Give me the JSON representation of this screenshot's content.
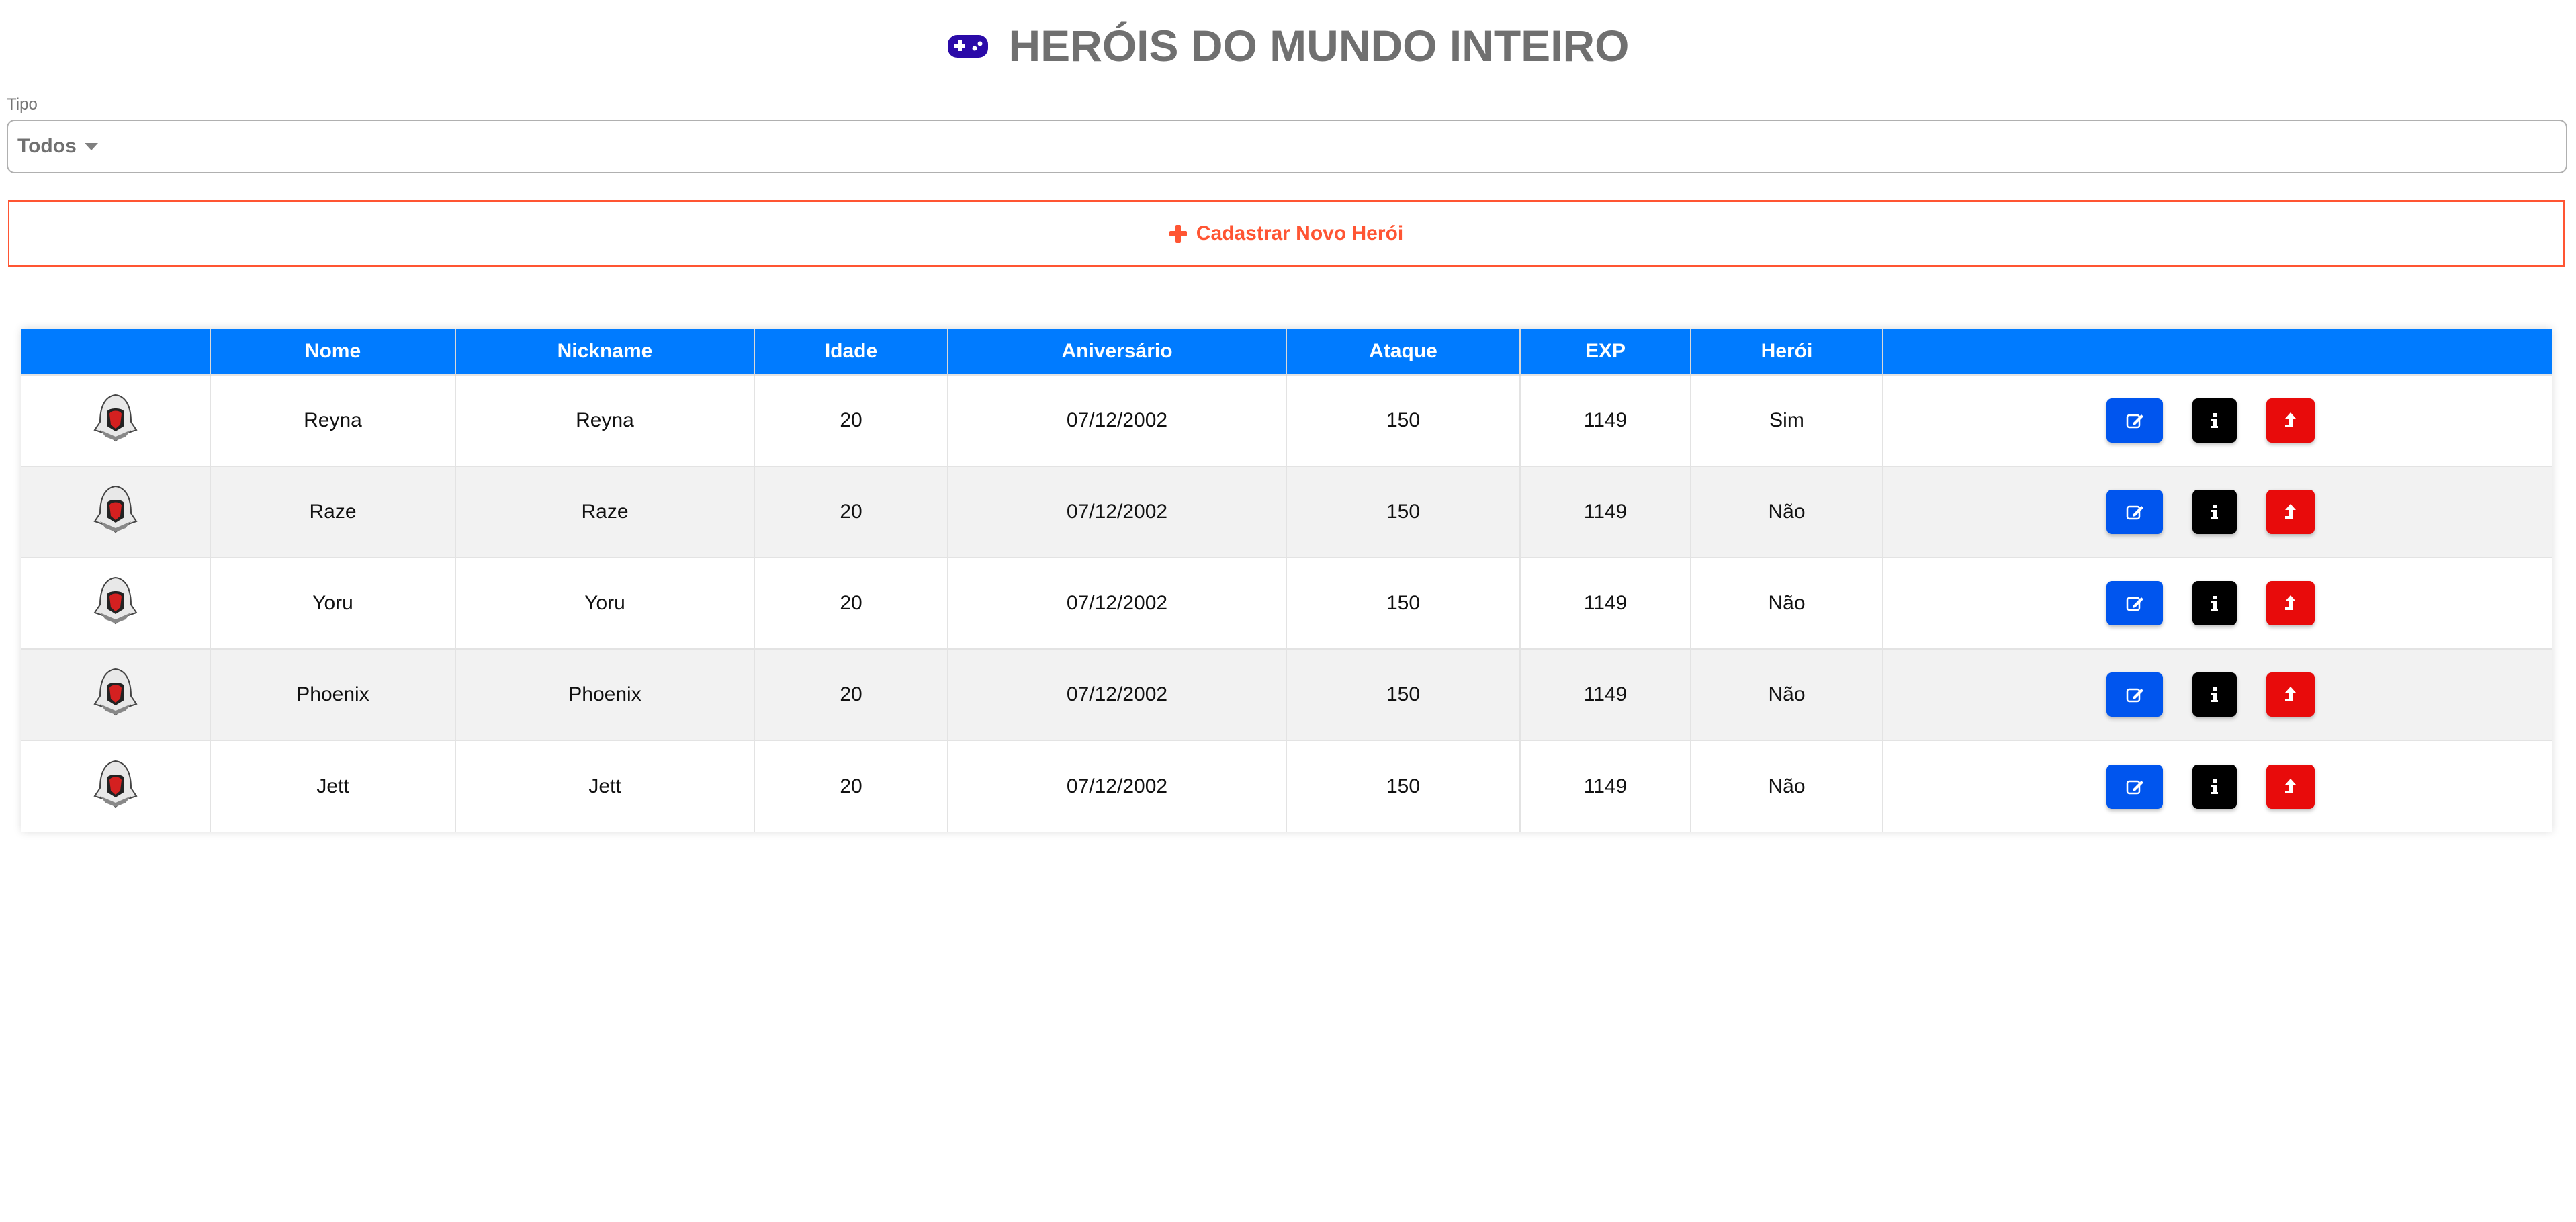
{
  "header": {
    "title": "HERÓIS DO MUNDO INTEIRO",
    "icon": "gamepad-icon",
    "icon_color": "#2a0aa8"
  },
  "filter": {
    "label": "Tipo",
    "selected": "Todos"
  },
  "add_button": {
    "label": "Cadastrar Novo Herói",
    "color": "#ff5533"
  },
  "table": {
    "header_color": "#007bff",
    "columns": [
      "",
      "Nome",
      "Nickname",
      "Idade",
      "Aniversário",
      "Ataque",
      "EXP",
      "Herói",
      ""
    ],
    "rows": [
      {
        "nome": "Reyna",
        "nickname": "Reyna",
        "idade": "20",
        "aniversario": "07/12/2002",
        "ataque": "150",
        "exp": "1149",
        "heroi": "Sim"
      },
      {
        "nome": "Raze",
        "nickname": "Raze",
        "idade": "20",
        "aniversario": "07/12/2002",
        "ataque": "150",
        "exp": "1149",
        "heroi": "Não"
      },
      {
        "nome": "Yoru",
        "nickname": "Yoru",
        "idade": "20",
        "aniversario": "07/12/2002",
        "ataque": "150",
        "exp": "1149",
        "heroi": "Não"
      },
      {
        "nome": "Phoenix",
        "nickname": "Phoenix",
        "idade": "20",
        "aniversario": "07/12/2002",
        "ataque": "150",
        "exp": "1149",
        "heroi": "Não"
      },
      {
        "nome": "Jett",
        "nickname": "Jett",
        "idade": "20",
        "aniversario": "07/12/2002",
        "ataque": "150",
        "exp": "1149",
        "heroi": "Não"
      }
    ],
    "action_colors": {
      "edit": "#0055ee",
      "info": "#000000",
      "delete": "#e80b0b"
    }
  }
}
